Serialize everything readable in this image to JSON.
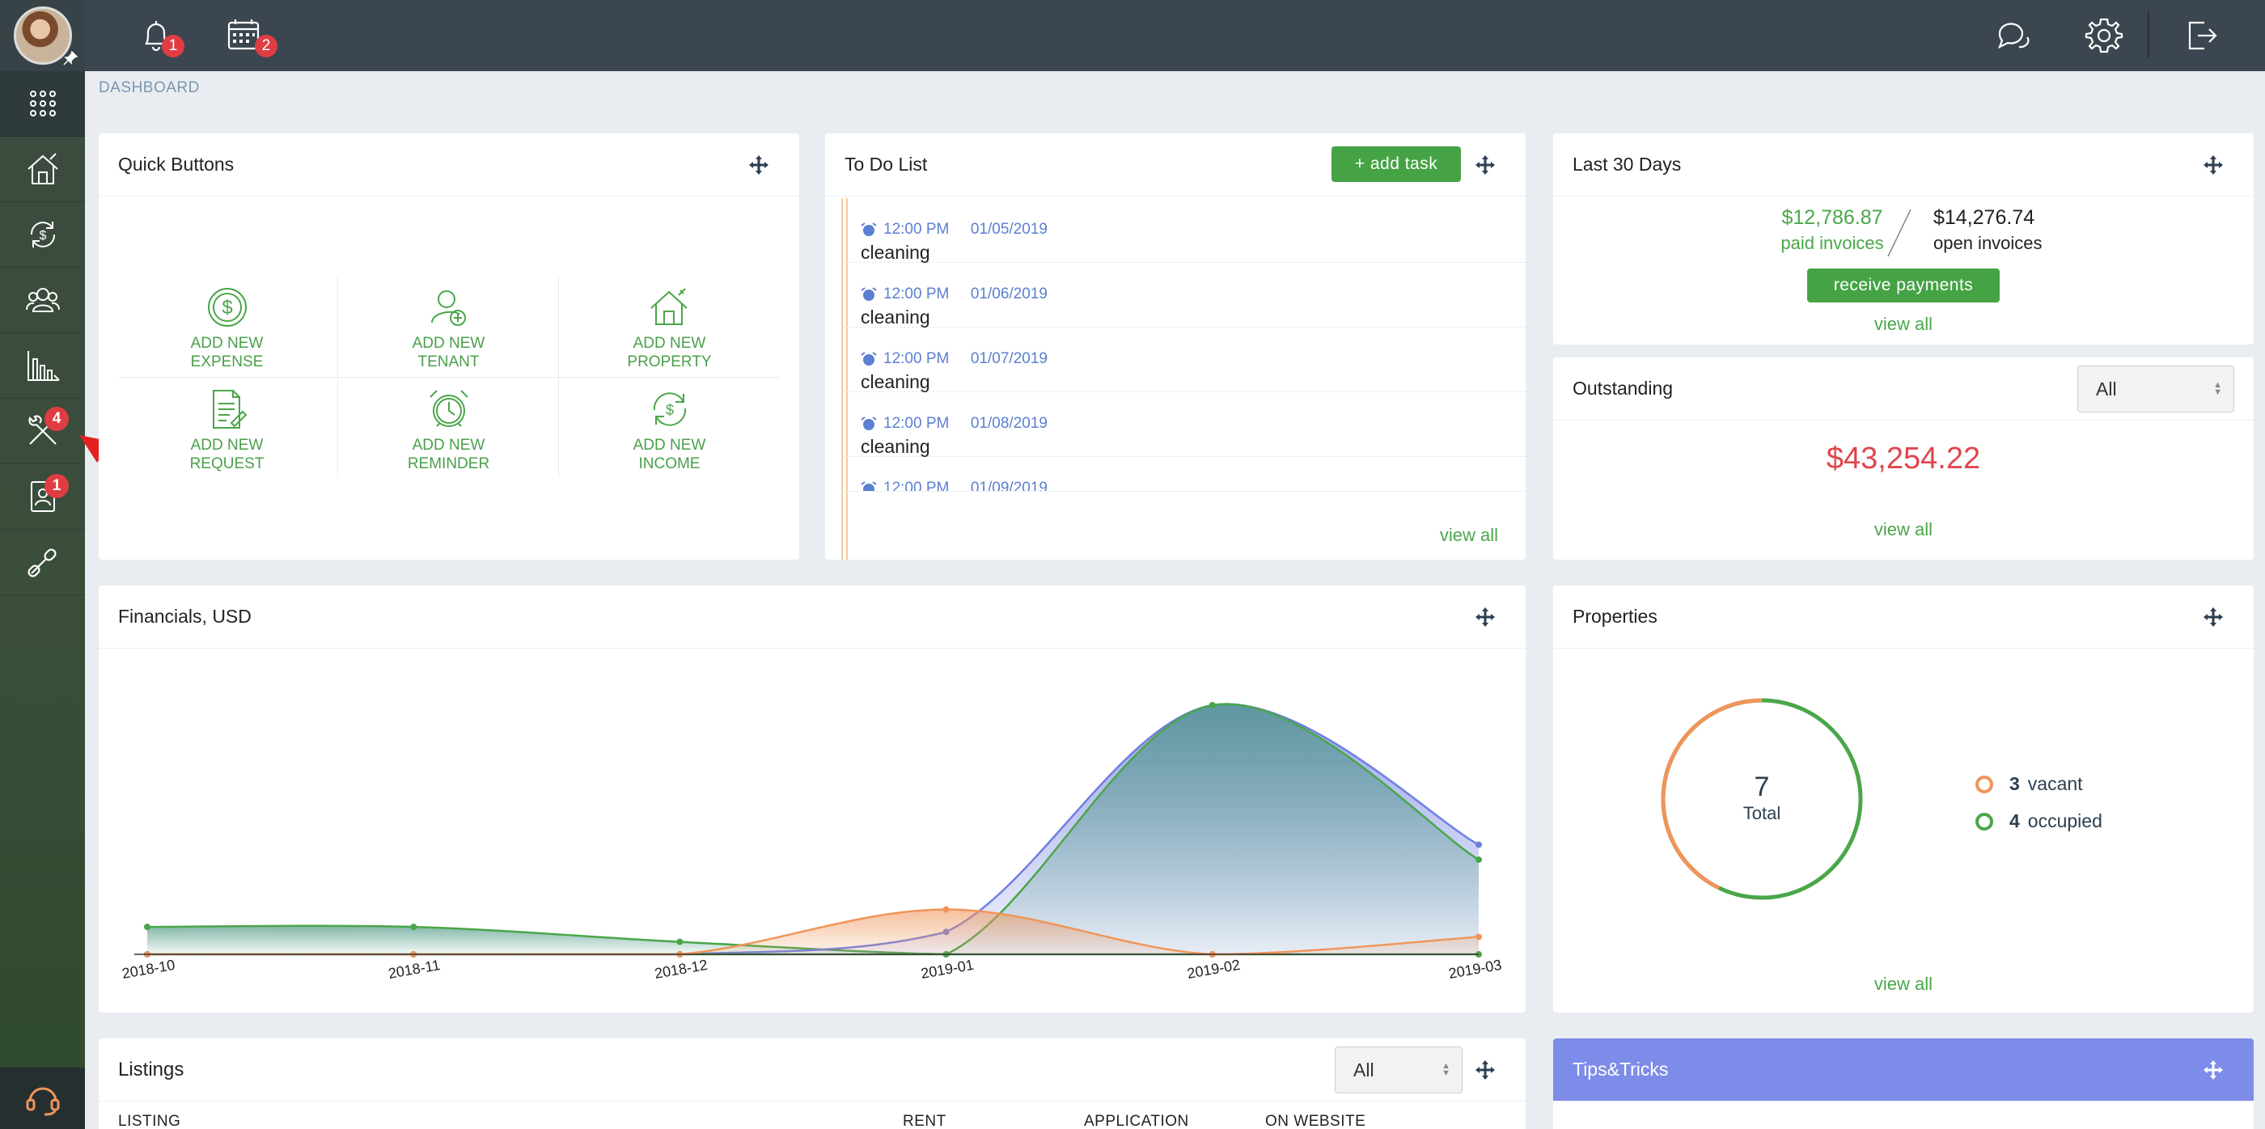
{
  "sidebar": {
    "badges": {
      "maintenance": "4",
      "contacts": "1"
    }
  },
  "topbar": {
    "notifications_badge": "1",
    "calendar_badge": "2"
  },
  "breadcrumb": "DASHBOARD",
  "quick_buttons": {
    "title": "Quick Buttons",
    "items": [
      {
        "line1": "ADD NEW",
        "line2": "EXPENSE",
        "icon": "dollar-icon"
      },
      {
        "line1": "ADD NEW",
        "line2": "TENANT",
        "icon": "add-user-icon"
      },
      {
        "line1": "ADD NEW",
        "line2": "PROPERTY",
        "icon": "house-icon"
      },
      {
        "line1": "ADD NEW",
        "line2": "REQUEST",
        "icon": "document-icon"
      },
      {
        "line1": "ADD NEW",
        "line2": "REMINDER",
        "icon": "alarm-clock-icon"
      },
      {
        "line1": "ADD NEW",
        "line2": "INCOME",
        "icon": "income-icon"
      }
    ]
  },
  "todo": {
    "title": "To Do List",
    "add_label": "+ add task",
    "view_all": "view all",
    "items": [
      {
        "time": "12:00 PM",
        "date": "01/05/2019",
        "task": "cleaning"
      },
      {
        "time": "12:00 PM",
        "date": "01/06/2019",
        "task": "cleaning"
      },
      {
        "time": "12:00 PM",
        "date": "01/07/2019",
        "task": "cleaning"
      },
      {
        "time": "12:00 PM",
        "date": "01/08/2019",
        "task": "cleaning"
      },
      {
        "time": "12:00 PM",
        "date": "01/09/2019",
        "task": "cleaning"
      }
    ]
  },
  "last30": {
    "title": "Last 30 Days",
    "paid_amount": "$12,786.87",
    "paid_label": "paid invoices",
    "open_amount": "$14,276.74",
    "open_label": "open invoices",
    "button": "receive payments",
    "view_all": "view all"
  },
  "outstanding": {
    "title": "Outstanding",
    "filter": "All",
    "amount": "$43,254.22",
    "view_all": "view all"
  },
  "financials": {
    "title": "Financials, USD"
  },
  "properties": {
    "title": "Properties",
    "total": "7",
    "total_label": "Total",
    "vacant_count": "3",
    "vacant_label": "vacant",
    "occupied_count": "4",
    "occupied_label": "occupied",
    "vacant_fraction": 0.4286,
    "view_all": "view all"
  },
  "listings": {
    "title": "Listings",
    "filter": "All",
    "columns": [
      "LISTING",
      "RENT",
      "APPLICATION",
      "ON WEBSITE"
    ]
  },
  "tips": {
    "title": "Tips&Tricks"
  },
  "colors": {
    "green": "#4aa64a",
    "blue": "#6f7fe0",
    "orange": "#f0955a",
    "red": "#e0464d"
  },
  "chart_data": {
    "type": "area",
    "x": [
      "2018-10",
      "2018-11",
      "2018-12",
      "2019-01",
      "2019-02",
      "2019-03"
    ],
    "series": [
      {
        "values": [
          0.11,
          0.11,
          0.05,
          0.0,
          0.0,
          0.0
        ],
        "color": "#4aa64a"
      },
      {
        "values": [
          0.0,
          0.0,
          0.0,
          0.09,
          1.0,
          0.44
        ],
        "color": "#6f7fe0"
      },
      {
        "values": [
          0.0,
          0.0,
          0.0,
          0.0,
          1.0,
          0.38
        ],
        "color": "#4aa64a"
      },
      {
        "values": [
          0.0,
          0.0,
          0.0,
          0.18,
          0.0,
          0.07
        ],
        "color": "#f0955a"
      }
    ],
    "ylim": [
      0,
      1
    ]
  }
}
